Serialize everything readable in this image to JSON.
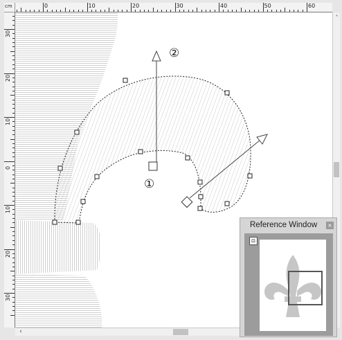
{
  "ruler": {
    "corner_unit": "cm",
    "h_labels": [
      "0",
      "10",
      "20",
      "30",
      "40",
      "50",
      "60"
    ],
    "v_labels": [
      "30",
      "20",
      "10",
      "0",
      "10",
      "20",
      "30"
    ]
  },
  "canvas": {
    "markers": {
      "start": "①",
      "end": "②"
    }
  },
  "reference_window": {
    "title": "Reference Window",
    "close_label": "×"
  },
  "icons": {
    "ref_window_icon": "view-frame-icon",
    "scroll_left": "chevron-left-icon",
    "scroll_up": "chevron-up-icon",
    "scroll_down": "chevron-down-icon"
  },
  "colors": {
    "stitch": "#c8c8c8",
    "outline": "#222222",
    "preview_fill": "#c6c6c6",
    "preview_frame": "#555555"
  }
}
